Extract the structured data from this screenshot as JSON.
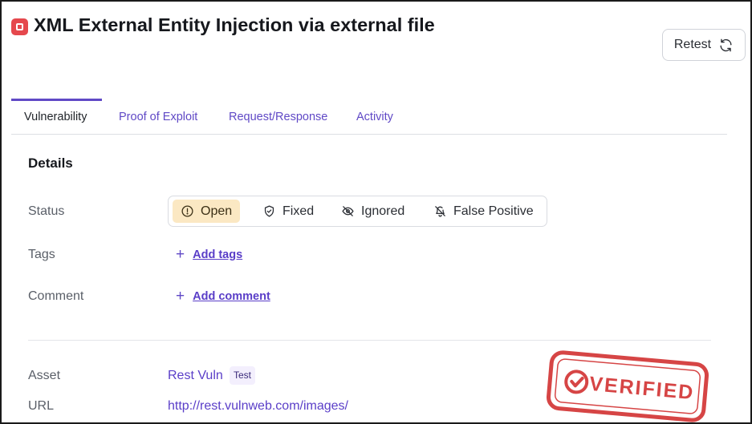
{
  "header": {
    "title": "XML External Entity Injection via external file",
    "severity_icon": "critical-severity-icon",
    "severity_color": "#e5484d",
    "retest_label": "Retest"
  },
  "tabs": [
    {
      "label": "Vulnerability",
      "active": true
    },
    {
      "label": "Proof of Exploit",
      "active": false
    },
    {
      "label": "Request/Response",
      "active": false
    },
    {
      "label": "Activity",
      "active": false
    }
  ],
  "details": {
    "section_title": "Details",
    "status_label": "Status",
    "status_options": [
      {
        "label": "Open",
        "icon": "info-circle-icon",
        "selected": true
      },
      {
        "label": "Fixed",
        "icon": "shield-check-icon",
        "selected": false
      },
      {
        "label": "Ignored",
        "icon": "eye-off-icon",
        "selected": false
      },
      {
        "label": "False Positive",
        "icon": "bell-off-icon",
        "selected": false
      }
    ],
    "tags_label": "Tags",
    "add_tags": "Add tags",
    "comment_label": "Comment",
    "add_comment": "Add comment"
  },
  "meta": {
    "asset_label": "Asset",
    "asset_name": "Rest Vuln",
    "asset_badge": "Test",
    "url_label": "URL",
    "url": "http://rest.vulnweb.com/images/"
  },
  "stamp": {
    "text": "VERIFIED",
    "color": "#d64545"
  },
  "colors": {
    "accent": "#6049c6",
    "selected_status_bg": "#fbe8c3"
  }
}
